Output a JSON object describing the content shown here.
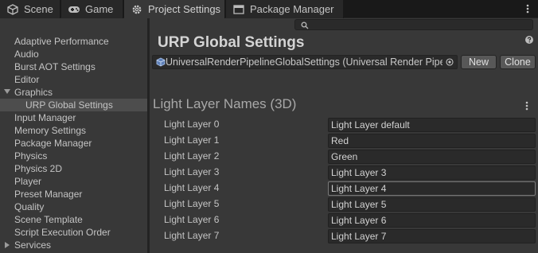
{
  "tabs": [
    {
      "label": "Scene",
      "icon": "scene-icon",
      "active": false
    },
    {
      "label": "Game",
      "icon": "game-controller-icon",
      "active": false
    },
    {
      "label": "Project Settings",
      "icon": "gear-icon",
      "active": true
    },
    {
      "label": "Package Manager",
      "icon": "package-icon",
      "active": false
    }
  ],
  "search": {
    "value": ""
  },
  "sidebar": {
    "items": [
      {
        "label": "Adaptive Performance",
        "selected": false
      },
      {
        "label": "Audio",
        "selected": false
      },
      {
        "label": "Burst AOT Settings",
        "selected": false
      },
      {
        "label": "Editor",
        "selected": false
      },
      {
        "label": "Graphics",
        "selected": false,
        "expanded": true
      },
      {
        "label": "URP Global Settings",
        "selected": true
      },
      {
        "label": "Input Manager",
        "selected": false
      },
      {
        "label": "Memory Settings",
        "selected": false
      },
      {
        "label": "Package Manager",
        "selected": false
      },
      {
        "label": "Physics",
        "selected": false
      },
      {
        "label": "Physics 2D",
        "selected": false
      },
      {
        "label": "Player",
        "selected": false
      },
      {
        "label": "Preset Manager",
        "selected": false
      },
      {
        "label": "Quality",
        "selected": false
      },
      {
        "label": "Scene Template",
        "selected": false
      },
      {
        "label": "Script Execution Order",
        "selected": false
      },
      {
        "label": "Services",
        "selected": false,
        "expanded": false
      }
    ]
  },
  "main": {
    "title": "URP Global Settings",
    "asset_field": {
      "value": "UniversalRenderPipelineGlobalSettings (Universal Render Pipe"
    },
    "new_label": "New",
    "clone_label": "Clone",
    "section_title": "Light Layer Names (3D)",
    "rows": [
      {
        "label": "Light Layer 0",
        "value": "Light Layer default"
      },
      {
        "label": "Light Layer 1",
        "value": "Red"
      },
      {
        "label": "Light Layer 2",
        "value": "Green"
      },
      {
        "label": "Light Layer 3",
        "value": "Light Layer 3"
      },
      {
        "label": "Light Layer 4",
        "value": "Light Layer 4",
        "focused": true
      },
      {
        "label": "Light Layer 5",
        "value": "Light Layer 5"
      },
      {
        "label": "Light Layer 6",
        "value": "Light Layer 6"
      },
      {
        "label": "Light Layer 7",
        "value": "Light Layer 7"
      }
    ]
  },
  "colors": {
    "background": "#383838",
    "tabbar": "#191919",
    "selection": "#4d4d4d",
    "field": "#2a2a2a",
    "button": "#585858"
  }
}
